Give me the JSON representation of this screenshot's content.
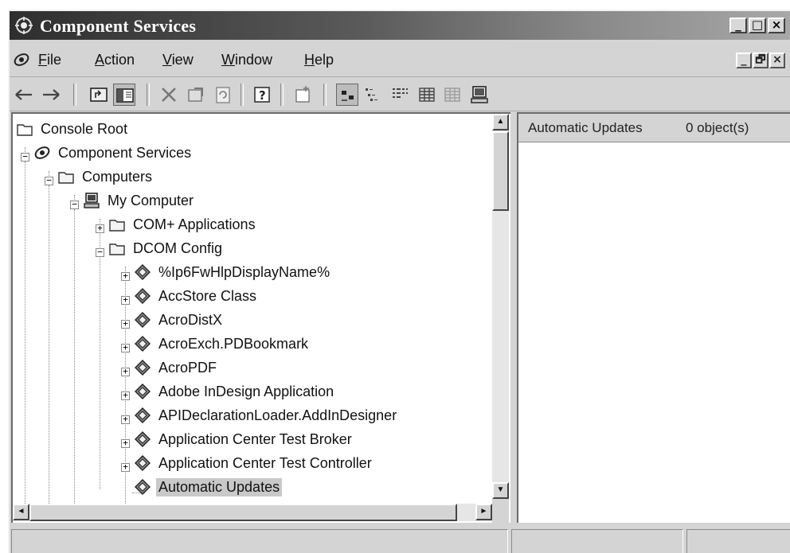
{
  "window": {
    "title": "Component Services",
    "caption_buttons": [
      "_",
      "□",
      "×"
    ],
    "mdi_buttons": [
      "_",
      "🗗",
      "×"
    ]
  },
  "menu": {
    "items": [
      {
        "label": "File",
        "accel": "F",
        "rest": "ile"
      },
      {
        "label": "Action",
        "accel": "A",
        "rest": "ction"
      },
      {
        "label": "View",
        "accel": "V",
        "rest": "iew"
      },
      {
        "label": "Window",
        "accel": "W",
        "rest": "indow"
      },
      {
        "label": "Help",
        "accel": "H",
        "rest": "elp"
      }
    ]
  },
  "toolbar": {
    "buttons": [
      "back-arrow-icon",
      "forward-arrow-icon",
      "up-one-level-icon",
      "show-hide-console-tree-icon",
      "delete-icon",
      "properties-icon",
      "refresh-icon",
      "help-icon",
      "new-window-icon",
      "large-icons-icon",
      "small-icons-icon",
      "list-icon",
      "detail-icon",
      "details-grid-icon",
      "computer-icon"
    ]
  },
  "tree": {
    "nodes": [
      {
        "label": "Console Root",
        "icon": "folder-icon"
      },
      {
        "label": "Component Services",
        "icon": "component-services-icon"
      },
      {
        "label": "Computers",
        "icon": "folder-icon"
      },
      {
        "label": "My Computer",
        "icon": "computer-icon"
      },
      {
        "label": "COM+ Applications",
        "icon": "folder-icon"
      },
      {
        "label": "DCOM Config",
        "icon": "folder-icon"
      },
      {
        "label": "%Ip6FwHlpDisplayName%",
        "icon": "dcom-component-icon"
      },
      {
        "label": "AccStore Class",
        "icon": "dcom-component-icon"
      },
      {
        "label": "AcroDistX",
        "icon": "dcom-component-icon"
      },
      {
        "label": "AcroExch.PDBookmark",
        "icon": "dcom-component-icon"
      },
      {
        "label": "AcroPDF",
        "icon": "dcom-component-icon"
      },
      {
        "label": "Adobe InDesign Application",
        "icon": "dcom-component-icon"
      },
      {
        "label": "APIDeclarationLoader.AddInDesigner",
        "icon": "dcom-component-icon"
      },
      {
        "label": "Application Center Test Broker",
        "icon": "dcom-component-icon"
      },
      {
        "label": "Application Center Test Controller",
        "icon": "dcom-component-icon"
      },
      {
        "label": "Automatic Updates",
        "icon": "dcom-component-icon",
        "selected": true
      }
    ]
  },
  "details": {
    "name": "Automatic Updates",
    "count": "0 object(s)"
  },
  "scrollbar_arrows": {
    "up": "▲",
    "down": "▼",
    "left": "◄",
    "right": "►"
  }
}
